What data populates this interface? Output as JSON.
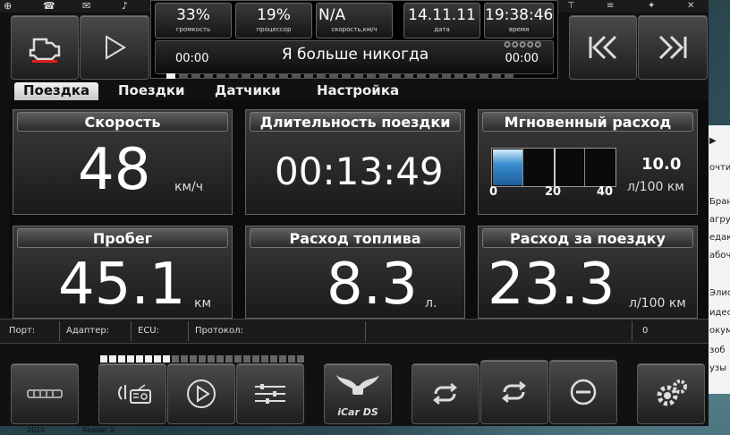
{
  "top_info": {
    "volume": {
      "value": "33%",
      "label": "громкость"
    },
    "cpu": {
      "value": "19%",
      "label": "процессор"
    },
    "speed": {
      "value": "N/A",
      "label": "скорость,км/ч"
    },
    "date": {
      "value": "14.11.11",
      "label": "дата"
    },
    "time": {
      "value": "19:38:46",
      "label": "время"
    }
  },
  "track": {
    "title": "Я больше никогда",
    "elapsed": "00:00",
    "total": "00:00",
    "rating_stars": 5,
    "progress": 0.05
  },
  "tabs": [
    {
      "label": "Поездка",
      "active": true
    },
    {
      "label": "Поездки",
      "active": false
    },
    {
      "label": "Датчики",
      "active": false
    },
    {
      "label": "Настройка",
      "active": false
    }
  ],
  "panels": {
    "speed": {
      "title": "Скорость",
      "value": "48",
      "unit": "км/ч"
    },
    "duration": {
      "title": "Длительность поездки",
      "value": "00:13:49"
    },
    "instant": {
      "title": "Мгновенный расход",
      "value": "10.0",
      "unit": "л/100 км",
      "scale": [
        "0",
        "20",
        "40"
      ],
      "fill_fraction": 0.25
    },
    "mileage": {
      "title": "Пробег",
      "value": "45.1",
      "unit": "км"
    },
    "fuel": {
      "title": "Расход топлива",
      "value": "8.3",
      "unit": "л."
    },
    "trip_consumption": {
      "title": "Расход за поездку",
      "value": "23.3",
      "unit": "л/100 км"
    }
  },
  "statusbar": {
    "port": "Порт:",
    "adapter": "Адаптер:",
    "ecu": "ECU:",
    "protocol": "Протокол:",
    "counter": "0"
  },
  "bottom": {
    "logo_text": "iCar DS",
    "volume_level": 0.35
  },
  "desktop": {
    "right_window_lines": [
      "Бран",
      "агру",
      "едак",
      "абоч",
      "Элис",
      "идес",
      "окум",
      "зоб",
      "узы"
    ],
    "search_fragment": "очти",
    "taskbar": [
      "2010",
      "Reader X"
    ]
  }
}
